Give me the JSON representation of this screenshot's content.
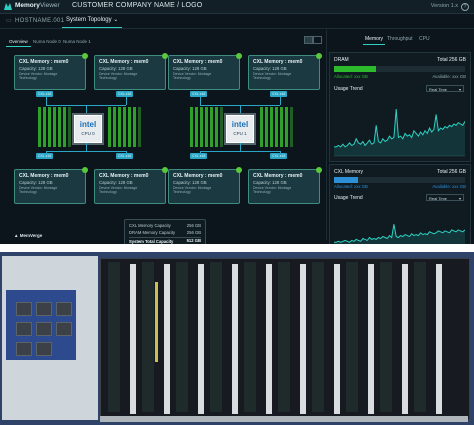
{
  "app": {
    "name_bold": "Memory",
    "name_light": "Viewer",
    "company": "CUSTOMER COMPANY NAME / LOGO",
    "version": "Version 1.x",
    "help_glyph": "?"
  },
  "subbar": {
    "hostname": "HOSTNAME.001",
    "view_selector": "System Topology ⌄"
  },
  "left": {
    "tabs": [
      "Overview",
      "Numa Node 0",
      "Numa Node 1"
    ],
    "cards_top": [
      {
        "title": "CXL Memory : mem0",
        "capacity": "Capacity: 128 GB",
        "desc": "Device Vendor: Montage Technology"
      },
      {
        "title": "CXL Memory : mem0",
        "capacity": "Capacity: 128 GB",
        "desc": "Device Vendor: Montage Technology"
      },
      {
        "title": "CXL Memory : mem0",
        "capacity": "Capacity: 128 GB",
        "desc": "Device Vendor: Montage Technology"
      },
      {
        "title": "CXL Memory : mem0",
        "capacity": "Capacity: 128 GB",
        "desc": "Device Vendor: Montage Technology"
      }
    ],
    "cards_bottom": [
      {
        "title": "CXL Memory : mem0",
        "capacity": "Capacity: 128 GB",
        "desc": "Device Vendor: Montage Technology"
      },
      {
        "title": "CXL Memory : mem0",
        "capacity": "Capacity: 128 GB",
        "desc": "Device Vendor: Montage Technology"
      },
      {
        "title": "CXL Memory : mem0",
        "capacity": "Capacity: 128 GB",
        "desc": "Device Vendor: Montage Technology"
      },
      {
        "title": "CXL Memory : mem0",
        "capacity": "Capacity: 128 GB",
        "desc": "Device Vendor: Montage Technology"
      }
    ],
    "link_label": "CXL x16",
    "cpus": [
      {
        "brand": "intel",
        "label": "CPU 0"
      },
      {
        "brand": "intel",
        "label": "CPU 1"
      }
    ],
    "summary": {
      "rows": [
        {
          "label": "CXL Memory Capacity",
          "value": "256 GB"
        },
        {
          "label": "DRAM Memory Capacity",
          "value": "256 GB"
        }
      ],
      "total": {
        "label": "System Total Capacity",
        "value": "512 GB"
      }
    },
    "footer_logo": "MemVerge"
  },
  "right": {
    "tabs": [
      "Memory",
      "Throughput",
      "CPU"
    ],
    "dram": {
      "title": "DRAM",
      "total": "Total 256 GB",
      "allocated": "Allocated: xxx GB",
      "available": "Available: xxx GB",
      "usage_fraction": 0.32,
      "trend_label": "Usage Trend",
      "range": "Real Time",
      "trend": [
        6,
        6,
        7,
        6,
        8,
        6,
        7,
        9,
        7,
        8,
        12,
        9,
        8,
        10,
        7,
        9,
        11,
        8,
        9,
        22,
        10,
        9,
        12,
        10,
        11,
        14,
        12,
        13,
        34,
        13,
        14,
        12,
        16,
        14,
        15,
        13,
        18,
        16,
        14,
        17,
        15,
        18,
        16,
        20,
        17,
        19,
        30,
        18,
        20,
        19,
        21,
        20,
        22,
        21,
        23,
        22,
        24,
        23,
        22,
        25
      ]
    },
    "cxl": {
      "title": "CXL Memory",
      "total": "Total 256 GB",
      "allocated": "Allocated: xxx GB",
      "available": "Available: xxx GB",
      "usage_fraction": 0.18,
      "trend_label": "Usage Trend",
      "range": "Real Time",
      "trend": [
        5,
        5,
        6,
        5,
        6,
        7,
        6,
        5,
        7,
        6,
        8,
        7,
        6,
        9,
        8,
        7,
        10,
        8,
        9,
        8,
        10,
        9,
        11,
        10,
        9,
        12,
        10,
        24,
        11,
        10,
        12,
        11,
        13,
        12,
        11,
        14,
        12,
        13,
        12,
        15,
        13,
        14,
        13,
        16,
        15,
        14,
        15,
        17,
        16,
        15,
        17,
        16,
        15,
        18,
        17,
        16,
        18,
        17,
        16,
        18
      ]
    },
    "colors": {
      "green": "#2dbb2d",
      "blue": "#2d8fd6",
      "accent": "#2fd0c2",
      "line": "#2fd0c2"
    }
  }
}
